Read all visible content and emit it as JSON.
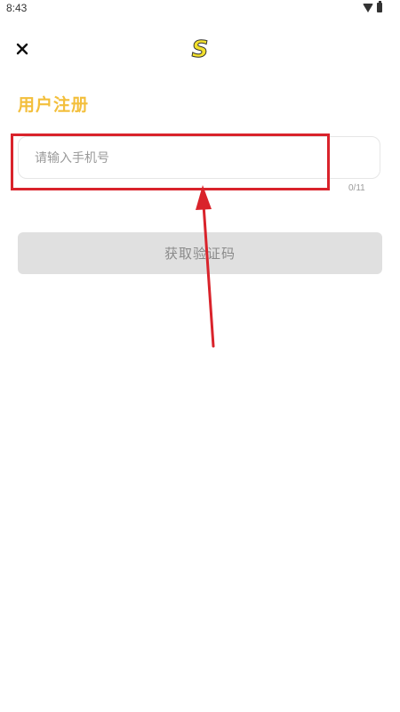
{
  "status_bar": {
    "time": "8:43",
    "icons": [
      "wifi-icon",
      "battery-icon"
    ]
  },
  "header": {
    "close_icon": "close-icon",
    "logo_text": "S"
  },
  "title": "用户注册",
  "phone_field": {
    "value": "",
    "placeholder": "请输入手机号",
    "counter": "0/11"
  },
  "buttons": {
    "get_code": "获取验证码"
  },
  "colors": {
    "accent": "#f3bf3c",
    "annotation": "#d9232b",
    "button_disabled": "#e0e0e0"
  }
}
